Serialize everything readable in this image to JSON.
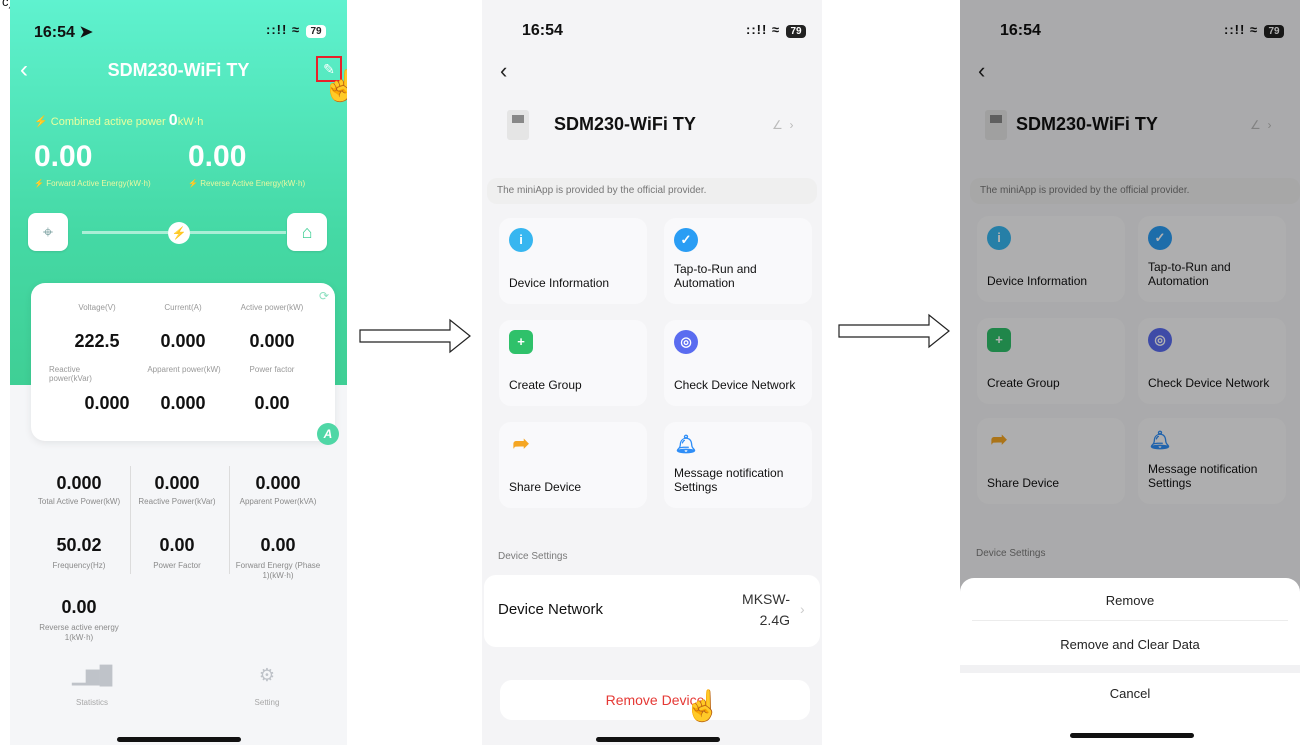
{
  "figure_label": "c)",
  "status": {
    "time": "16:54",
    "battery": "79",
    "signal": "::!! ≈"
  },
  "screen1": {
    "title": "SDM230-WiFi TY",
    "combined_label": "Combined active power",
    "combined_value": "0",
    "combined_unit": "kW·h",
    "forward_value": "0.00",
    "reverse_value": "0.00",
    "forward_label": "Forward Active Energy(kW·h)",
    "reverse_label": "Reverse Active Energy(kW·h)",
    "card": {
      "row1": [
        {
          "label": "Voltage(V)",
          "value": "222.5"
        },
        {
          "label": "Current(A)",
          "value": "0.000"
        },
        {
          "label": "Active power(kW)",
          "value": "0.000"
        }
      ],
      "row2": [
        {
          "label": "Reactive power(kVar)",
          "value": "0.000"
        },
        {
          "label": "Apparent power(kW)",
          "value": "0.000"
        },
        {
          "label": "Power factor",
          "value": "0.00"
        }
      ],
      "badge": "A"
    },
    "grid": [
      {
        "value": "0.000",
        "label": "Total Active Power(kW)"
      },
      {
        "value": "0.000",
        "label": "Reactive Power(kVar)"
      },
      {
        "value": "0.000",
        "label": "Apparent Power(kVA)"
      },
      {
        "value": "50.02",
        "label": "Frequency(Hz)"
      },
      {
        "value": "0.00",
        "label": "Power Factor"
      },
      {
        "value": "0.00",
        "label": "Forward Energy (Phase 1)(kW·h)"
      },
      {
        "value": "0.00",
        "label": "Reverse active energy 1(kW·h)"
      }
    ],
    "tabs": [
      {
        "label": "Statistics",
        "icon": "bar-chart-icon"
      },
      {
        "label": "Setting",
        "icon": "gear-icon"
      }
    ]
  },
  "screen2": {
    "device_name": "SDM230-WiFi TY",
    "provider_note": "The miniApp is provided by the official provider.",
    "tiles": [
      {
        "label": "Device Information",
        "icon": "info-icon",
        "color": "#37b6f0"
      },
      {
        "label": "Tap-to-Run and Automation",
        "icon": "check-shield-icon",
        "color": "#2a9df4"
      },
      {
        "label": "Create Group",
        "icon": "group-icon",
        "color": "#2fc16a"
      },
      {
        "label": "Check Device Network",
        "icon": "network-icon",
        "color": "#5a6cf0"
      },
      {
        "label": "Share Device",
        "icon": "share-icon",
        "color": "#f5a623"
      },
      {
        "label": "Message notification Settings",
        "icon": "bell-icon",
        "color": "#2f8ef7"
      }
    ],
    "section_label": "Device Settings",
    "network_label": "Device Network",
    "network_value": "MKSW-\n2.4G",
    "remove_label": "Remove Device"
  },
  "screen3": {
    "sheet_options": [
      "Remove",
      "Remove and Clear Data",
      "Cancel"
    ]
  },
  "colors": {
    "accent_green": "#45d9a5",
    "remove_red": "#e53935",
    "highlight_red": "#e8202a"
  }
}
